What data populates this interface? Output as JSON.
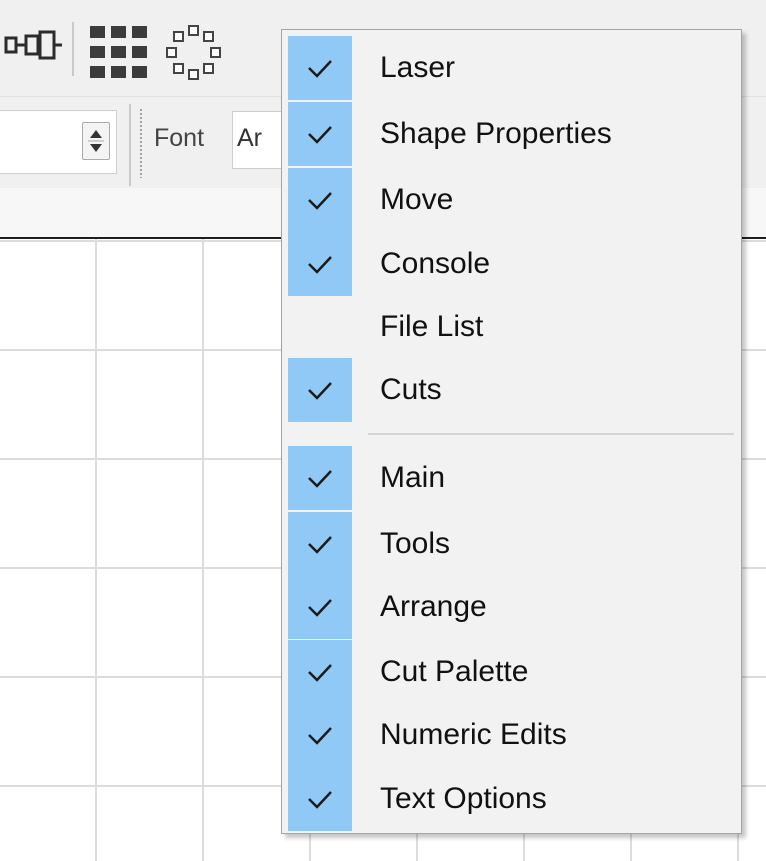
{
  "toolbar": {
    "boolean_icon": "boolean-union-icon",
    "grid_icon": "grid-array-icon",
    "circle_icon": "circular-array-icon",
    "spin_icon": "spin-updown-icon",
    "font_label": "Font",
    "font_value": "Ar"
  },
  "context_menu": {
    "groups": [
      {
        "items": [
          {
            "label": "Laser",
            "checked": true
          },
          {
            "label": "Shape Properties",
            "checked": true
          },
          {
            "label": "Move",
            "checked": true
          },
          {
            "label": "Console",
            "checked": true
          },
          {
            "label": "File List",
            "checked": false
          },
          {
            "label": "Cuts",
            "checked": true
          }
        ]
      },
      {
        "items": [
          {
            "label": "Main",
            "checked": true
          },
          {
            "label": "Tools",
            "checked": true
          },
          {
            "label": "Arrange",
            "checked": true
          },
          {
            "label": "Cut Palette",
            "checked": true
          },
          {
            "label": "Numeric Edits",
            "checked": true
          },
          {
            "label": "Text Options",
            "checked": true
          }
        ]
      }
    ]
  },
  "colors": {
    "check_highlight": "#90c8f6",
    "menu_background": "#f2f2f2",
    "toolbar_background": "#f0f0f0"
  }
}
